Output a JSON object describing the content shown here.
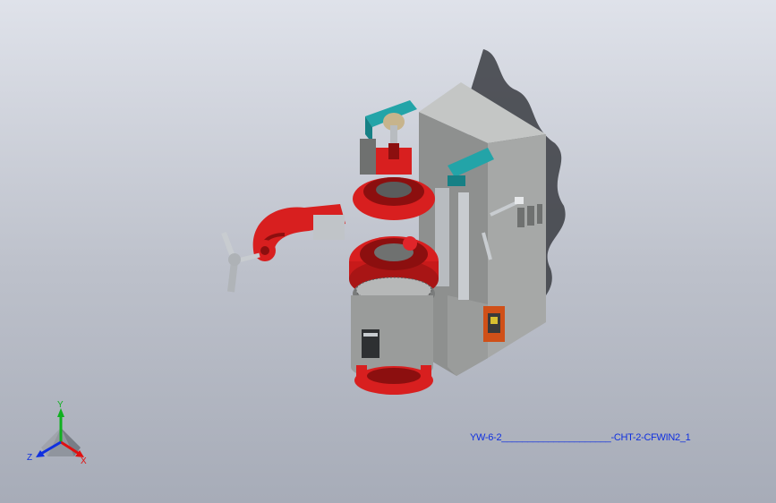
{
  "viewport": {
    "background_top": "#dfe2ea",
    "background_bottom": "#a7acb8"
  },
  "model": {
    "part_label": "YW-6-2_____________________-CHT-2-CFWIN2_1",
    "colors": {
      "housing": "#9c9e9c",
      "housing_dark": "#6f7170",
      "red_parts": "#d81f1f",
      "red_dark": "#8c0f0f",
      "teal_parts": "#23a4a8",
      "steel": "#c8ccd0",
      "shadow": "#3a3c42"
    }
  },
  "triad": {
    "x_label": "X",
    "y_label": "Y",
    "z_label": "Z",
    "x_color": "#e01010",
    "y_color": "#10b020",
    "z_color": "#1030e0"
  }
}
